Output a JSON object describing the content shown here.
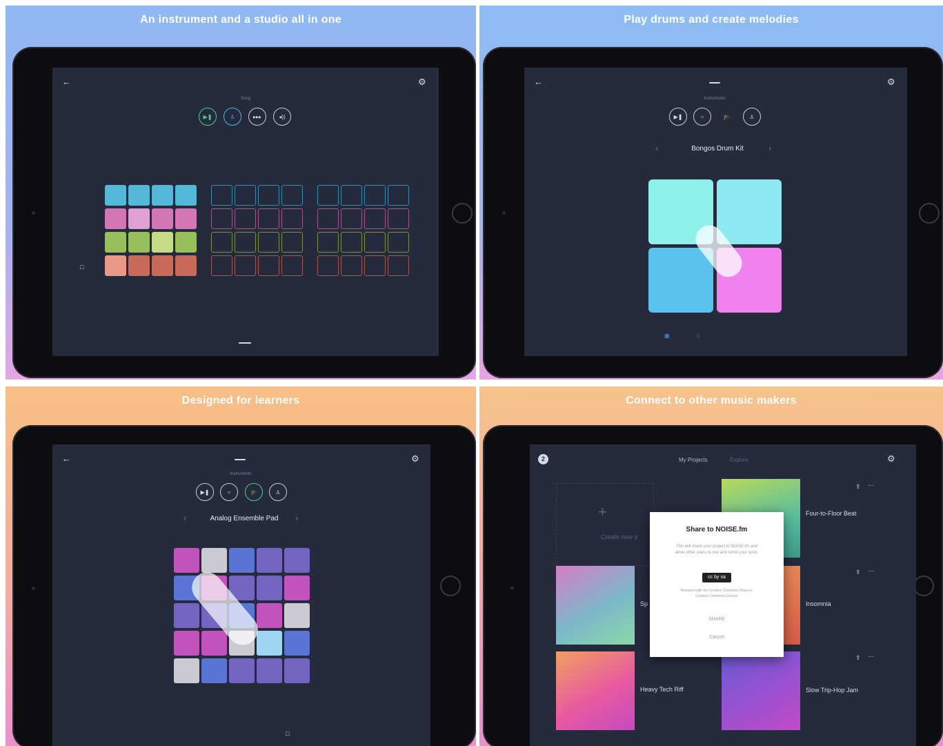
{
  "panels": [
    {
      "headline": "An instrument and a studio all in one",
      "screen_caption": "Song",
      "colors": {
        "teal": "#54b8d8",
        "pink": "#d476b4",
        "green": "#98c05a",
        "salmon": "#e89a86",
        "rust": "#c86a5a"
      }
    },
    {
      "headline": "Play drums and create melodies",
      "screen_caption": "Instruments",
      "instrument_name": "Bongos Drum Kit",
      "colors": {
        "cyan1": "#8ff0ec",
        "cyan2": "#8de8f2",
        "blue": "#5bc4ee",
        "pink": "#ef82ec"
      }
    },
    {
      "headline": "Designed for learners",
      "screen_caption": "Instruments",
      "instrument_name": "Analog Ensemble Pad",
      "colors": {
        "magenta": "#c253bd",
        "grey": "#cdcbd2",
        "blue": "#5a74d4",
        "violet": "#7465c2",
        "lightblue": "#9ed6f2"
      }
    },
    {
      "headline": "Connect to other music makers",
      "tabs": [
        "My Projects",
        "Explore"
      ],
      "avatar_badge": "2",
      "create_label": "Create new p",
      "projects": [
        {
          "title": "Four-to-Floor Beat"
        },
        {
          "title": "Sp"
        },
        {
          "title": "Insomnia"
        },
        {
          "title": "Heavy Tech Riff"
        },
        {
          "title": "Slow Trip-Hop Jam"
        }
      ],
      "dialog": {
        "title": "Share to NOISE.fm",
        "body": "This will share your project to NOISE.fm and allow other users to use and remix your work.",
        "license_badge": "cc by sa",
        "license_text": "Released with the Creative Commons Share-a-Creative Commons License",
        "share_label": "SHARE",
        "cancel_label": "Cancel"
      }
    }
  ]
}
